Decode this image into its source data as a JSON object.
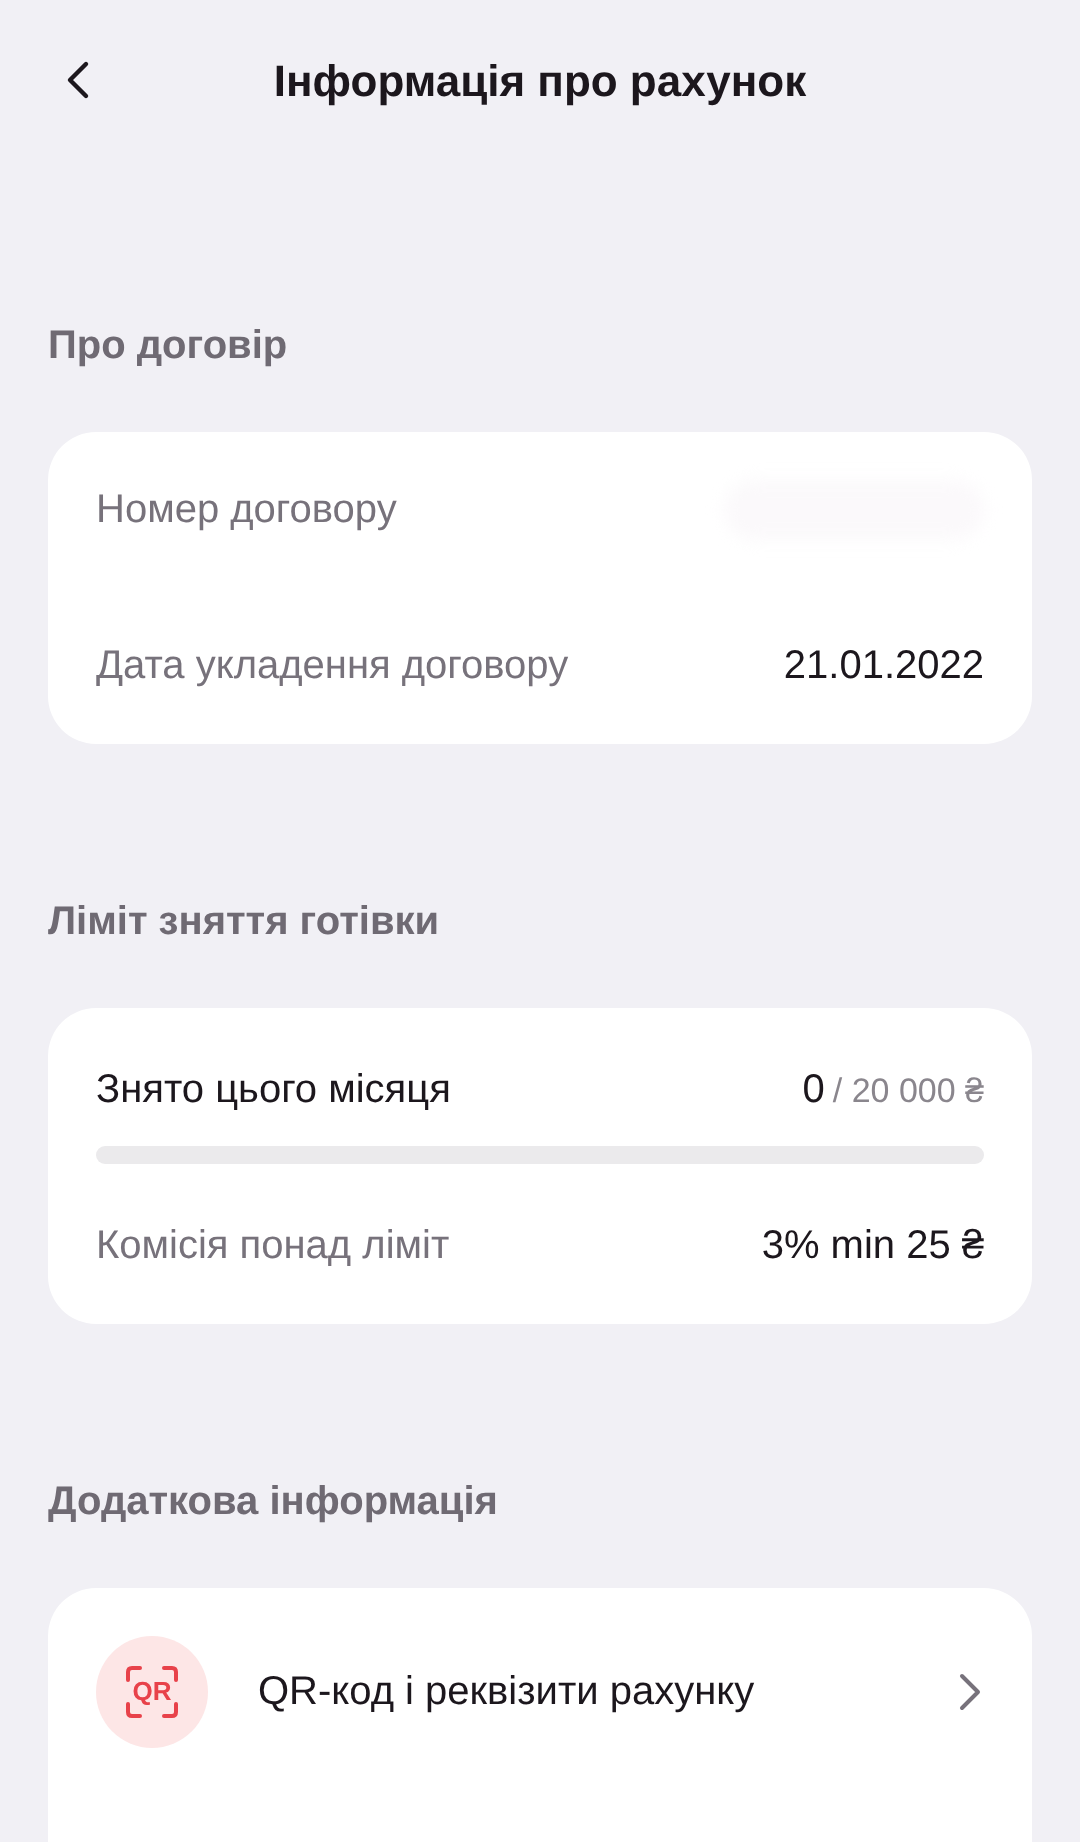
{
  "header": {
    "title": "Інформація про рахунок"
  },
  "contract": {
    "heading": "Про договір",
    "rows": [
      {
        "kind": "hidden",
        "label": "Номер договору"
      },
      {
        "kind": "text",
        "label": "Дата укладення договору",
        "value": "21.01.2022"
      }
    ]
  },
  "limit": {
    "heading": "Ліміт зняття готівки",
    "withdrawn": {
      "label": "Знято цього місяця",
      "value": "0",
      "total": "/ 20 000 ₴",
      "level": 0
    },
    "fee": {
      "label": "Комісія понад ліміт",
      "value": "3% min 25 ₴"
    }
  },
  "extra": {
    "heading": "Додаткова інформація",
    "items": [
      {
        "icon_text": "QR",
        "label": "QR-код і реквізити рахунку"
      }
    ]
  }
}
